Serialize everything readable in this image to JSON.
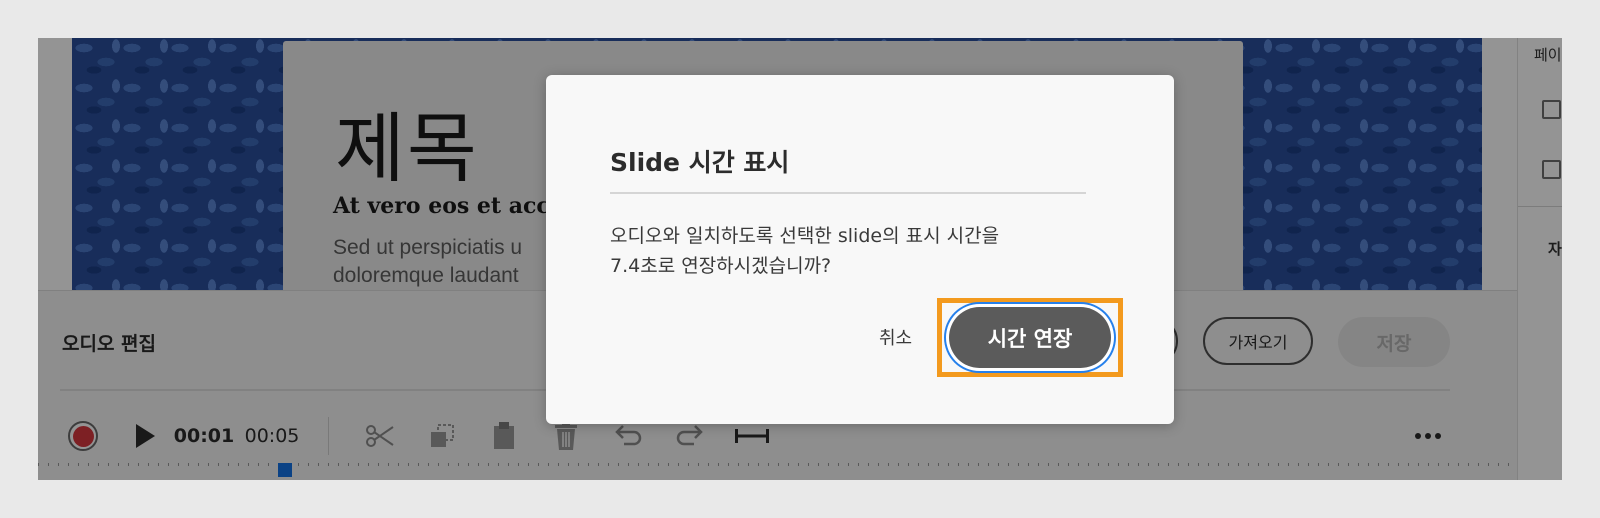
{
  "slide": {
    "title": "제목",
    "subtitle": "At vero eos et accu",
    "body_line1": "Sed ut perspiciatis u",
    "body_line2": "doloremque laudant"
  },
  "right_panel": {
    "label_top": "페이",
    "label_bottom": "자막"
  },
  "audio_panel": {
    "title": "오디오 편집",
    "partial_button_label": "",
    "import_button": "가져오기",
    "save_button": "저장",
    "current_time": "00:01",
    "total_time": "00:05",
    "icons": [
      "record-icon",
      "play-icon",
      "scissors-icon",
      "copy-icon",
      "paste-icon",
      "trash-icon",
      "undo-icon",
      "redo-icon",
      "fit-width-icon",
      "more-icon"
    ]
  },
  "dialog": {
    "title": "Slide 시간 표시",
    "message_line1": "오디오와 일치하도록 선택한 slide의 표시 시간을",
    "message_line2": "7.4초로 연장하시겠습니까?",
    "cancel_label": "취소",
    "confirm_label": "시간 연장",
    "highlight_color": "#f39a1e"
  },
  "colors": {
    "record": "#d7373f",
    "playhead": "#1473e6",
    "focus_ring": "#2680eb"
  }
}
